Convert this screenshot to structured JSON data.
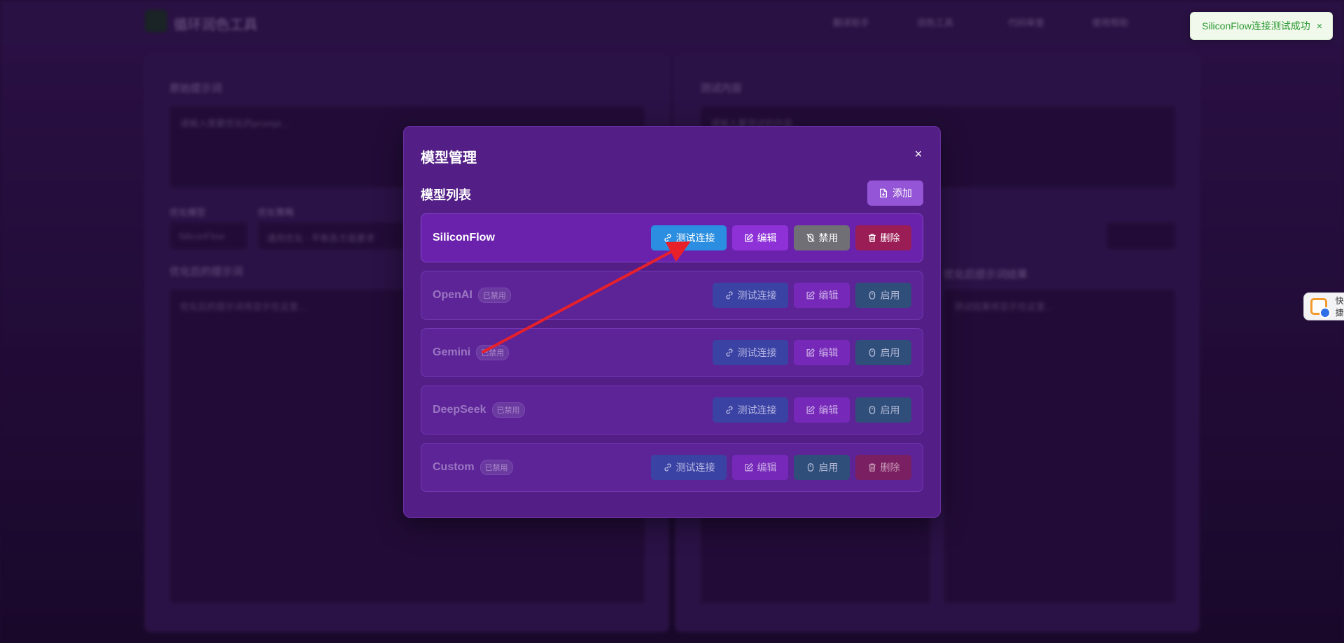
{
  "background": {
    "app_title": "循环润色工具",
    "nav": [
      "翻译助手",
      "润色工具",
      "代码审查",
      "使用帮助"
    ],
    "left_panel": {
      "input_label": "原始提示词",
      "input_placeholder": "请输入需要优化的prompt...",
      "select1_label": "优化模型",
      "select1_value": "SiliconFlow",
      "select2_label": "优化策略",
      "select2_value": "通用优化 - 平衡各方面要求",
      "result_label": "优化后的提示词",
      "result_placeholder": "优化后的提示词将显示在这里..."
    },
    "right_panel": {
      "test_label": "测试内容",
      "test_placeholder": "请输入要测试的内容...",
      "compare_label": "优化后提示词结果",
      "compare_placeholder": "测试结果将显示在这里..."
    }
  },
  "toast": {
    "message": "SiliconFlow连接测试成功",
    "close": "×",
    "accent": "#2e9a35"
  },
  "side_widget": {
    "label": "快捷"
  },
  "modal": {
    "title": "模型管理",
    "close": "×",
    "list_title": "模型列表",
    "add_label": "添加",
    "models": [
      {
        "name": "SiliconFlow",
        "status": "",
        "buttons": [
          "测试连接",
          "编辑",
          "禁用",
          "删除"
        ]
      },
      {
        "name": "OpenAI",
        "status": "已禁用",
        "buttons": [
          "测试连接",
          "编辑",
          "启用"
        ]
      },
      {
        "name": "Gemini",
        "status": "已禁用",
        "buttons": [
          "测试连接",
          "编辑",
          "启用"
        ]
      },
      {
        "name": "DeepSeek",
        "status": "已禁用",
        "buttons": [
          "测试连接",
          "编辑",
          "启用"
        ]
      },
      {
        "name": "Custom",
        "status": "已禁用",
        "buttons": [
          "测试连接",
          "编辑",
          "启用",
          "删除"
        ]
      }
    ]
  },
  "colors": {
    "modal_bg": "#531f86",
    "test_button": "#2b8ee0",
    "edit_button": "#8e32d8",
    "disable_button": "#6f6f75",
    "delete_button": "#9b1d55",
    "enable_button": "#2a567e",
    "annotation_arrow": "#e8202a"
  }
}
